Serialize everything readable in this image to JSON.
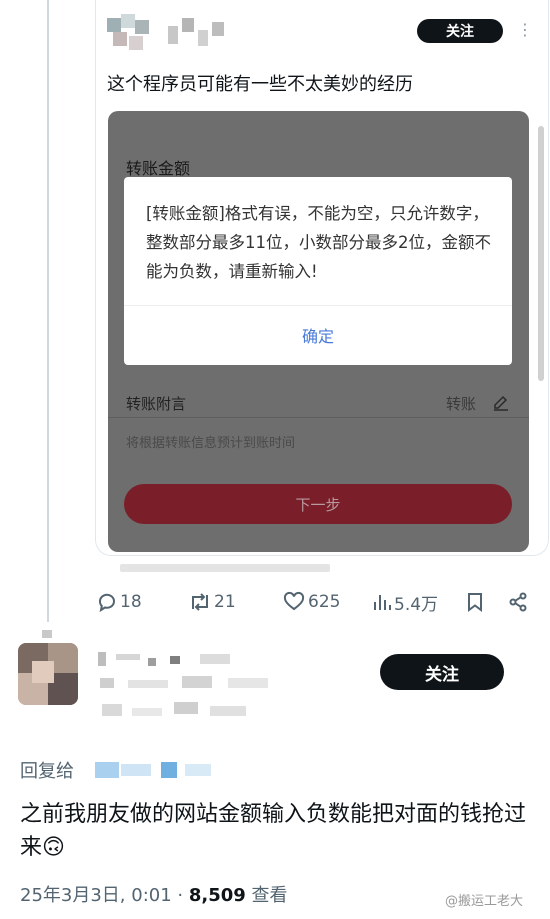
{
  "quoted_post": {
    "follow_label": "关注",
    "text": "这个程序员可能有一些不太美妙的经历",
    "screenshot": {
      "amount_label": "转账金额",
      "dialog_message": "[转账金额]格式有误，不能为空，只允许数字，整数部分最多11位，小数部分最多2位，金额不能为负数，请重新输入!",
      "dialog_ok": "确定",
      "note_label": "转账附言",
      "note_action": "转账",
      "hint": "将根据转账信息预计到账时间",
      "next_label": "下一步"
    },
    "stats": {
      "replies": "18",
      "retweets": "21",
      "likes": "625",
      "views": "5.4万"
    }
  },
  "reply": {
    "follow_label": "关注",
    "reply_to_label": "回复给",
    "text": "之前我朋友做的网站金额输入负数能把对面的钱抢过来🙃",
    "date": "25年3月3日, 0:01 · ",
    "views_count": "8,509",
    "views_label": " 查看"
  },
  "watermark": "@搬运工老大"
}
